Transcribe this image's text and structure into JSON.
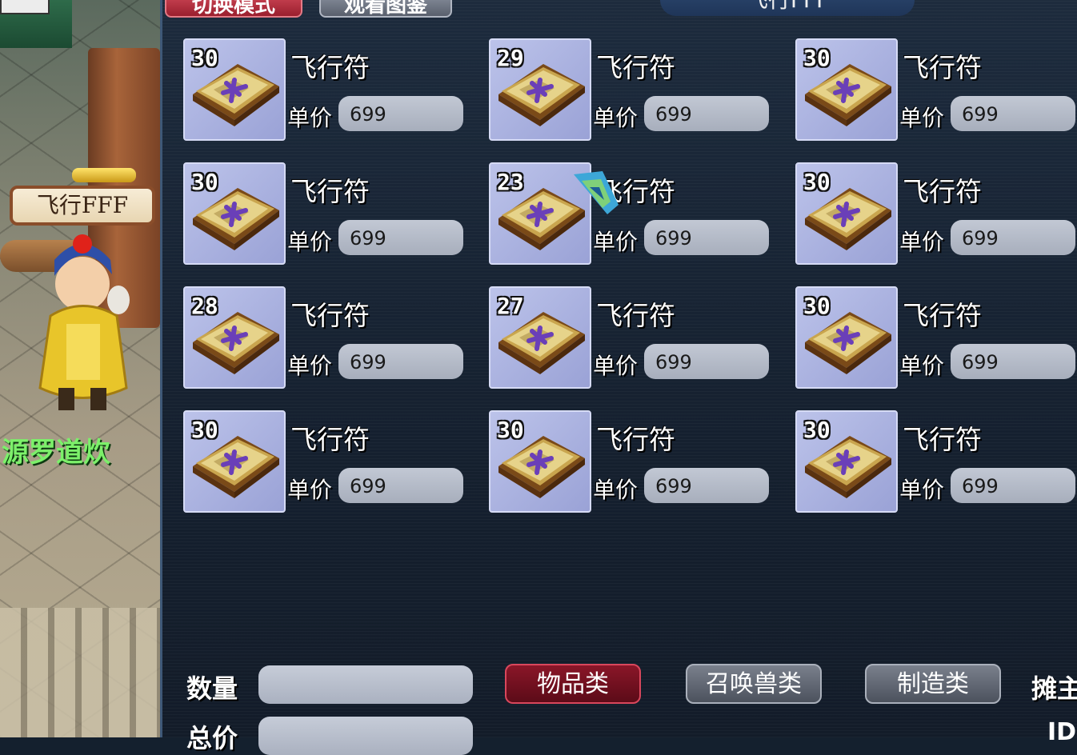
{
  "scene": {
    "stall_sign": "飞行FFF",
    "player_name": "源罗道炊"
  },
  "panel": {
    "tabs": {
      "switch_mode": "切换模式",
      "view_guide": "观看图鉴"
    },
    "stall_title": "飞行FFF",
    "price_label": "单价",
    "items": [
      {
        "name": "飞行符",
        "qty": "30",
        "price": "699"
      },
      {
        "name": "飞行符",
        "qty": "29",
        "price": "699"
      },
      {
        "name": "飞行符",
        "qty": "30",
        "price": "699"
      },
      {
        "name": "飞行符",
        "qty": "30",
        "price": "699"
      },
      {
        "name": "飞行符",
        "qty": "23",
        "price": "699"
      },
      {
        "name": "飞行符",
        "qty": "30",
        "price": "699"
      },
      {
        "name": "飞行符",
        "qty": "28",
        "price": "699"
      },
      {
        "name": "飞行符",
        "qty": "27",
        "price": "699"
      },
      {
        "name": "飞行符",
        "qty": "30",
        "price": "699"
      },
      {
        "name": "飞行符",
        "qty": "30",
        "price": "699"
      },
      {
        "name": "飞行符",
        "qty": "30",
        "price": "699"
      },
      {
        "name": "飞行符",
        "qty": "30",
        "price": "699"
      }
    ],
    "quantity_label": "数量",
    "total_label": "总价",
    "quantity_value": "",
    "total_value": "",
    "categories": {
      "items": "物品类",
      "pets": "召唤兽类",
      "crafting": "制造类"
    },
    "owner_label": "摊主",
    "id_label": "ID"
  },
  "colors": {
    "active_tab": "#9a1f2e",
    "inactive_tab": "#59606d",
    "icon_bg": "#aab1dd",
    "price_box": "#b5bcc9",
    "panel_bg": "#18222f"
  },
  "icons": {
    "item_icon": "flying-talisman-icon",
    "cursor": "cursor-icon"
  }
}
